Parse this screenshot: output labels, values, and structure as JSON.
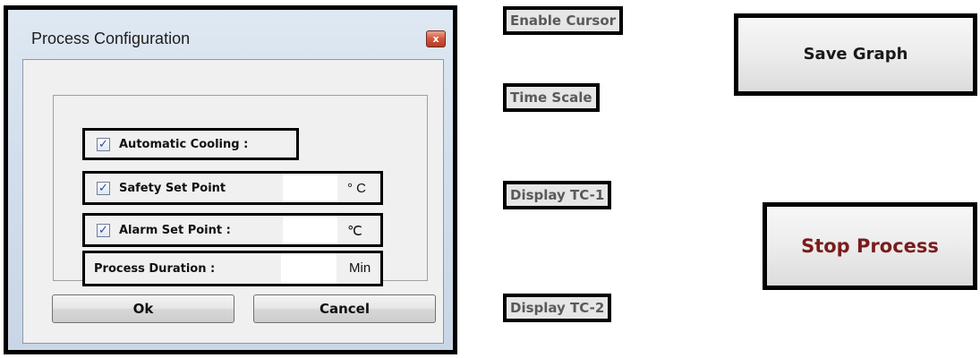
{
  "dialog": {
    "title": "Process Configuration",
    "close_glyph": "x",
    "automatic_cooling": {
      "label": "Automatic Cooling :",
      "checked": true
    },
    "safety_set_point": {
      "label": "Safety Set Point",
      "checked": true,
      "value": "",
      "unit": "° C"
    },
    "alarm_set_point": {
      "label": "Alarm Set Point :",
      "checked": true,
      "value": "",
      "unit": "℃"
    },
    "process_duration": {
      "label": "Process Duration :",
      "value": "",
      "unit": "Min"
    },
    "ok_label": "Ok",
    "cancel_label": "Cancel"
  },
  "labels": {
    "enable_cursor": "Enable Cursor",
    "time_scale": "Time Scale",
    "display_tc1": "Display TC-1",
    "display_tc2": "Display TC-2"
  },
  "buttons": {
    "save_graph": "Save Graph",
    "stop_process": "Stop Process"
  },
  "colors": {
    "stop_process_text": "#7b1c1c",
    "save_graph_text": "#1a1a1a",
    "checkmark": "#2c47a6",
    "label_text": "#5a5a5a"
  }
}
